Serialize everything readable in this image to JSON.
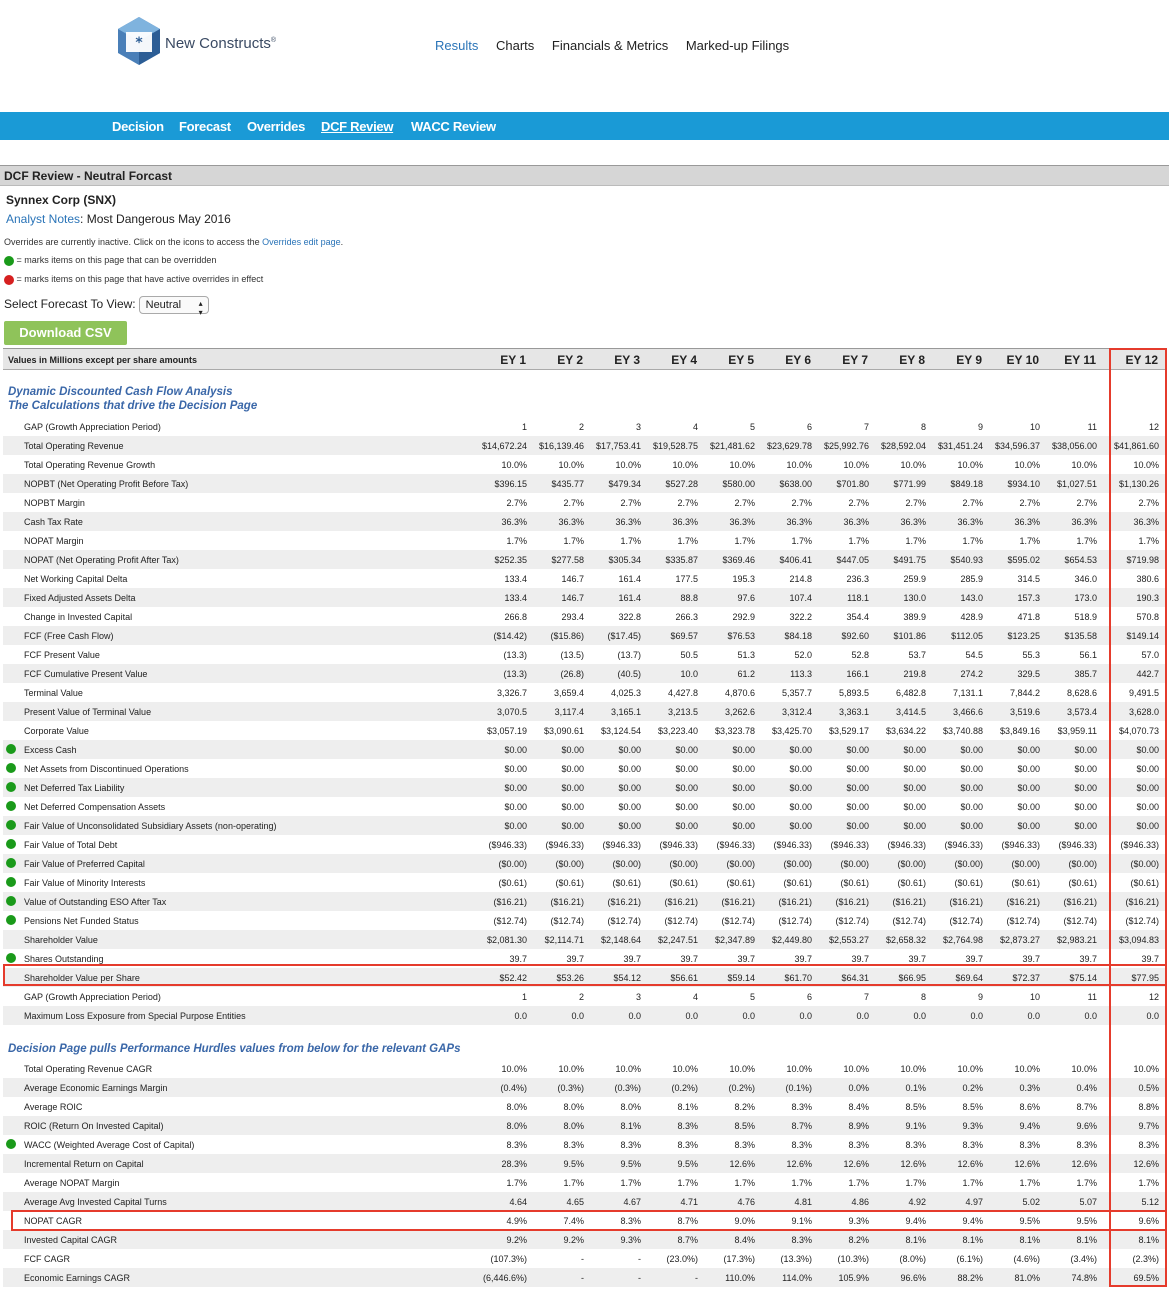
{
  "brand": {
    "name": "New Constructs",
    "mark": "®"
  },
  "top_nav": [
    "Results",
    "Charts",
    "Financials & Metrics",
    "Marked-up Filings"
  ],
  "sub_nav": [
    "Decision",
    "Forecast",
    "Overrides",
    "DCF Review",
    "WACC Review"
  ],
  "section_title": "DCF Review - Neutral Forcast",
  "company": "Synnex Corp (SNX)",
  "analyst_notes_label": "Analyst Notes",
  "analyst_notes_value": ": Most Dangerous May 2016",
  "overrides_msg_a": "Overrides are currently inactive. Click on the icons to access the ",
  "overrides_msg_link": "Overrides edit page",
  "overrides_msg_b": ".",
  "legend_green": "= marks items on this page that can be overridden",
  "legend_red": "= marks items on this page that have active overrides in effect",
  "select_label": "Select Forecast To View:",
  "select_value": "Neutral",
  "csv_button": "Download CSV",
  "table_header": "Values in Millions except per share amounts",
  "columns": [
    "EY 1",
    "EY 2",
    "EY 3",
    "EY 4",
    "EY 5",
    "EY 6",
    "EY 7",
    "EY 8",
    "EY 9",
    "EY 10",
    "EY 11",
    "EY 12"
  ],
  "section1_title": "Dynamic Discounted Cash Flow Analysis\nThe Calculations that drive the Decision Page",
  "section2_title": "Decision Page pulls Performance Hurdles values from below for the relevant GAPs",
  "colors": {
    "accent": "#1a9ad6",
    "link": "#2a74b8",
    "highlight": "#e53b2c",
    "green_dot": "#1a9a1a",
    "csv": "#8fc35a"
  },
  "rows1": [
    {
      "label": "GAP (Growth Appreciation Period)",
      "dot": false,
      "values": [
        "1",
        "2",
        "3",
        "4",
        "5",
        "6",
        "7",
        "8",
        "9",
        "10",
        "11",
        "12"
      ]
    },
    {
      "label": "Total Operating Revenue",
      "dot": false,
      "values": [
        "$14,672.24",
        "$16,139.46",
        "$17,753.41",
        "$19,528.75",
        "$21,481.62",
        "$23,629.78",
        "$25,992.76",
        "$28,592.04",
        "$31,451.24",
        "$34,596.37",
        "$38,056.00",
        "$41,861.60"
      ]
    },
    {
      "label": "Total Operating Revenue Growth",
      "dot": false,
      "values": [
        "10.0%",
        "10.0%",
        "10.0%",
        "10.0%",
        "10.0%",
        "10.0%",
        "10.0%",
        "10.0%",
        "10.0%",
        "10.0%",
        "10.0%",
        "10.0%"
      ]
    },
    {
      "label": "NOPBT (Net Operating Profit Before Tax)",
      "dot": false,
      "values": [
        "$396.15",
        "$435.77",
        "$479.34",
        "$527.28",
        "$580.00",
        "$638.00",
        "$701.80",
        "$771.99",
        "$849.18",
        "$934.10",
        "$1,027.51",
        "$1,130.26"
      ]
    },
    {
      "label": "NOPBT Margin",
      "dot": false,
      "values": [
        "2.7%",
        "2.7%",
        "2.7%",
        "2.7%",
        "2.7%",
        "2.7%",
        "2.7%",
        "2.7%",
        "2.7%",
        "2.7%",
        "2.7%",
        "2.7%"
      ]
    },
    {
      "label": "Cash Tax Rate",
      "dot": false,
      "values": [
        "36.3%",
        "36.3%",
        "36.3%",
        "36.3%",
        "36.3%",
        "36.3%",
        "36.3%",
        "36.3%",
        "36.3%",
        "36.3%",
        "36.3%",
        "36.3%"
      ]
    },
    {
      "label": "NOPAT Margin",
      "dot": false,
      "values": [
        "1.7%",
        "1.7%",
        "1.7%",
        "1.7%",
        "1.7%",
        "1.7%",
        "1.7%",
        "1.7%",
        "1.7%",
        "1.7%",
        "1.7%",
        "1.7%"
      ]
    },
    {
      "label": "NOPAT (Net Operating Profit After Tax)",
      "dot": false,
      "values": [
        "$252.35",
        "$277.58",
        "$305.34",
        "$335.87",
        "$369.46",
        "$406.41",
        "$447.05",
        "$491.75",
        "$540.93",
        "$595.02",
        "$654.53",
        "$719.98"
      ]
    },
    {
      "label": "Net Working Capital Delta",
      "dot": false,
      "values": [
        "133.4",
        "146.7",
        "161.4",
        "177.5",
        "195.3",
        "214.8",
        "236.3",
        "259.9",
        "285.9",
        "314.5",
        "346.0",
        "380.6"
      ]
    },
    {
      "label": "Fixed Adjusted Assets Delta",
      "dot": false,
      "values": [
        "133.4",
        "146.7",
        "161.4",
        "88.8",
        "97.6",
        "107.4",
        "118.1",
        "130.0",
        "143.0",
        "157.3",
        "173.0",
        "190.3"
      ]
    },
    {
      "label": "Change in Invested Capital",
      "dot": false,
      "values": [
        "266.8",
        "293.4",
        "322.8",
        "266.3",
        "292.9",
        "322.2",
        "354.4",
        "389.9",
        "428.9",
        "471.8",
        "518.9",
        "570.8"
      ]
    },
    {
      "label": "FCF (Free Cash Flow)",
      "dot": false,
      "values": [
        "($14.42)",
        "($15.86)",
        "($17.45)",
        "$69.57",
        "$76.53",
        "$84.18",
        "$92.60",
        "$101.86",
        "$112.05",
        "$123.25",
        "$135.58",
        "$149.14"
      ]
    },
    {
      "label": "FCF Present Value",
      "dot": false,
      "values": [
        "(13.3)",
        "(13.5)",
        "(13.7)",
        "50.5",
        "51.3",
        "52.0",
        "52.8",
        "53.7",
        "54.5",
        "55.3",
        "56.1",
        "57.0"
      ]
    },
    {
      "label": "FCF Cumulative Present Value",
      "dot": false,
      "values": [
        "(13.3)",
        "(26.8)",
        "(40.5)",
        "10.0",
        "61.2",
        "113.3",
        "166.1",
        "219.8",
        "274.2",
        "329.5",
        "385.7",
        "442.7"
      ]
    },
    {
      "label": "Terminal Value",
      "dot": false,
      "values": [
        "3,326.7",
        "3,659.4",
        "4,025.3",
        "4,427.8",
        "4,870.6",
        "5,357.7",
        "5,893.5",
        "6,482.8",
        "7,131.1",
        "7,844.2",
        "8,628.6",
        "9,491.5"
      ]
    },
    {
      "label": "Present Value of Terminal Value",
      "dot": false,
      "values": [
        "3,070.5",
        "3,117.4",
        "3,165.1",
        "3,213.5",
        "3,262.6",
        "3,312.4",
        "3,363.1",
        "3,414.5",
        "3,466.6",
        "3,519.6",
        "3,573.4",
        "3,628.0"
      ]
    },
    {
      "label": "Corporate Value",
      "dot": false,
      "values": [
        "$3,057.19",
        "$3,090.61",
        "$3,124.54",
        "$3,223.40",
        "$3,323.78",
        "$3,425.70",
        "$3,529.17",
        "$3,634.22",
        "$3,740.88",
        "$3,849.16",
        "$3,959.11",
        "$4,070.73"
      ]
    },
    {
      "label": "Excess Cash",
      "dot": true,
      "values": [
        "$0.00",
        "$0.00",
        "$0.00",
        "$0.00",
        "$0.00",
        "$0.00",
        "$0.00",
        "$0.00",
        "$0.00",
        "$0.00",
        "$0.00",
        "$0.00"
      ]
    },
    {
      "label": "Net Assets from Discontinued Operations",
      "dot": true,
      "values": [
        "$0.00",
        "$0.00",
        "$0.00",
        "$0.00",
        "$0.00",
        "$0.00",
        "$0.00",
        "$0.00",
        "$0.00",
        "$0.00",
        "$0.00",
        "$0.00"
      ]
    },
    {
      "label": "Net Deferred Tax Liability",
      "dot": true,
      "values": [
        "$0.00",
        "$0.00",
        "$0.00",
        "$0.00",
        "$0.00",
        "$0.00",
        "$0.00",
        "$0.00",
        "$0.00",
        "$0.00",
        "$0.00",
        "$0.00"
      ]
    },
    {
      "label": "Net Deferred Compensation Assets",
      "dot": true,
      "values": [
        "$0.00",
        "$0.00",
        "$0.00",
        "$0.00",
        "$0.00",
        "$0.00",
        "$0.00",
        "$0.00",
        "$0.00",
        "$0.00",
        "$0.00",
        "$0.00"
      ]
    },
    {
      "label": "Fair Value of Unconsolidated Subsidiary Assets (non-operating)",
      "dot": true,
      "values": [
        "$0.00",
        "$0.00",
        "$0.00",
        "$0.00",
        "$0.00",
        "$0.00",
        "$0.00",
        "$0.00",
        "$0.00",
        "$0.00",
        "$0.00",
        "$0.00"
      ]
    },
    {
      "label": "Fair Value of Total Debt",
      "dot": true,
      "values": [
        "($946.33)",
        "($946.33)",
        "($946.33)",
        "($946.33)",
        "($946.33)",
        "($946.33)",
        "($946.33)",
        "($946.33)",
        "($946.33)",
        "($946.33)",
        "($946.33)",
        "($946.33)"
      ]
    },
    {
      "label": "Fair Value of Preferred Capital",
      "dot": true,
      "values": [
        "($0.00)",
        "($0.00)",
        "($0.00)",
        "($0.00)",
        "($0.00)",
        "($0.00)",
        "($0.00)",
        "($0.00)",
        "($0.00)",
        "($0.00)",
        "($0.00)",
        "($0.00)"
      ]
    },
    {
      "label": "Fair Value of Minority Interests",
      "dot": true,
      "values": [
        "($0.61)",
        "($0.61)",
        "($0.61)",
        "($0.61)",
        "($0.61)",
        "($0.61)",
        "($0.61)",
        "($0.61)",
        "($0.61)",
        "($0.61)",
        "($0.61)",
        "($0.61)"
      ]
    },
    {
      "label": "Value of Outstanding ESO After Tax",
      "dot": true,
      "values": [
        "($16.21)",
        "($16.21)",
        "($16.21)",
        "($16.21)",
        "($16.21)",
        "($16.21)",
        "($16.21)",
        "($16.21)",
        "($16.21)",
        "($16.21)",
        "($16.21)",
        "($16.21)"
      ]
    },
    {
      "label": "Pensions Net Funded Status",
      "dot": true,
      "values": [
        "($12.74)",
        "($12.74)",
        "($12.74)",
        "($12.74)",
        "($12.74)",
        "($12.74)",
        "($12.74)",
        "($12.74)",
        "($12.74)",
        "($12.74)",
        "($12.74)",
        "($12.74)"
      ]
    },
    {
      "label": "Shareholder Value",
      "dot": false,
      "values": [
        "$2,081.30",
        "$2,114.71",
        "$2,148.64",
        "$2,247.51",
        "$2,347.89",
        "$2,449.80",
        "$2,553.27",
        "$2,658.32",
        "$2,764.98",
        "$2,873.27",
        "$2,983.21",
        "$3,094.83"
      ]
    },
    {
      "label": "Shares Outstanding",
      "dot": true,
      "values": [
        "39.7",
        "39.7",
        "39.7",
        "39.7",
        "39.7",
        "39.7",
        "39.7",
        "39.7",
        "39.7",
        "39.7",
        "39.7",
        "39.7"
      ]
    },
    {
      "label": "Shareholder Value per Share",
      "dot": false,
      "values": [
        "$52.42",
        "$53.26",
        "$54.12",
        "$56.61",
        "$59.14",
        "$61.70",
        "$64.31",
        "$66.95",
        "$69.64",
        "$72.37",
        "$75.14",
        "$77.95"
      ]
    },
    {
      "label": "GAP (Growth Appreciation Period)",
      "dot": false,
      "values": [
        "1",
        "2",
        "3",
        "4",
        "5",
        "6",
        "7",
        "8",
        "9",
        "10",
        "11",
        "12"
      ]
    },
    {
      "label": "Maximum Loss Exposure from Special Purpose Entities",
      "dot": false,
      "values": [
        "0.0",
        "0.0",
        "0.0",
        "0.0",
        "0.0",
        "0.0",
        "0.0",
        "0.0",
        "0.0",
        "0.0",
        "0.0",
        "0.0"
      ]
    }
  ],
  "rows2": [
    {
      "label": "Total Operating Revenue CAGR",
      "dot": false,
      "values": [
        "10.0%",
        "10.0%",
        "10.0%",
        "10.0%",
        "10.0%",
        "10.0%",
        "10.0%",
        "10.0%",
        "10.0%",
        "10.0%",
        "10.0%",
        "10.0%"
      ]
    },
    {
      "label": "Average Economic Earnings Margin",
      "dot": false,
      "values": [
        "(0.4%)",
        "(0.3%)",
        "(0.3%)",
        "(0.2%)",
        "(0.2%)",
        "(0.1%)",
        "0.0%",
        "0.1%",
        "0.2%",
        "0.3%",
        "0.4%",
        "0.5%"
      ]
    },
    {
      "label": "Average ROIC",
      "dot": false,
      "values": [
        "8.0%",
        "8.0%",
        "8.0%",
        "8.1%",
        "8.2%",
        "8.3%",
        "8.4%",
        "8.5%",
        "8.5%",
        "8.6%",
        "8.7%",
        "8.8%"
      ]
    },
    {
      "label": "ROIC (Return On Invested Capital)",
      "dot": false,
      "values": [
        "8.0%",
        "8.0%",
        "8.1%",
        "8.3%",
        "8.5%",
        "8.7%",
        "8.9%",
        "9.1%",
        "9.3%",
        "9.4%",
        "9.6%",
        "9.7%"
      ]
    },
    {
      "label": "WACC (Weighted Average Cost of Capital)",
      "dot": true,
      "values": [
        "8.3%",
        "8.3%",
        "8.3%",
        "8.3%",
        "8.3%",
        "8.3%",
        "8.3%",
        "8.3%",
        "8.3%",
        "8.3%",
        "8.3%",
        "8.3%"
      ]
    },
    {
      "label": "Incremental Return on Capital",
      "dot": false,
      "values": [
        "28.3%",
        "9.5%",
        "9.5%",
        "9.5%",
        "12.6%",
        "12.6%",
        "12.6%",
        "12.6%",
        "12.6%",
        "12.6%",
        "12.6%",
        "12.6%"
      ]
    },
    {
      "label": "Average NOPAT Margin",
      "dot": false,
      "values": [
        "1.7%",
        "1.7%",
        "1.7%",
        "1.7%",
        "1.7%",
        "1.7%",
        "1.7%",
        "1.7%",
        "1.7%",
        "1.7%",
        "1.7%",
        "1.7%"
      ]
    },
    {
      "label": "Average Avg Invested Capital Turns",
      "dot": false,
      "values": [
        "4.64",
        "4.65",
        "4.67",
        "4.71",
        "4.76",
        "4.81",
        "4.86",
        "4.92",
        "4.97",
        "5.02",
        "5.07",
        "5.12"
      ]
    },
    {
      "label": "NOPAT CAGR",
      "dot": false,
      "values": [
        "4.9%",
        "7.4%",
        "8.3%",
        "8.7%",
        "9.0%",
        "9.1%",
        "9.3%",
        "9.4%",
        "9.4%",
        "9.5%",
        "9.5%",
        "9.6%"
      ]
    },
    {
      "label": "Invested Capital CAGR",
      "dot": false,
      "values": [
        "9.2%",
        "9.2%",
        "9.3%",
        "8.7%",
        "8.4%",
        "8.3%",
        "8.2%",
        "8.1%",
        "8.1%",
        "8.1%",
        "8.1%",
        "8.1%"
      ]
    },
    {
      "label": "FCF CAGR",
      "dot": false,
      "values": [
        "(107.3%)",
        "-",
        "-",
        "(23.0%)",
        "(17.3%)",
        "(13.3%)",
        "(10.3%)",
        "(8.0%)",
        "(6.1%)",
        "(4.6%)",
        "(3.4%)",
        "(2.3%)"
      ]
    },
    {
      "label": "Economic Earnings CAGR",
      "dot": false,
      "values": [
        "(6,446.6%)",
        "-",
        "-",
        "-",
        "110.0%",
        "114.0%",
        "105.9%",
        "96.6%",
        "88.2%",
        "81.0%",
        "74.8%",
        "69.5%"
      ]
    }
  ]
}
